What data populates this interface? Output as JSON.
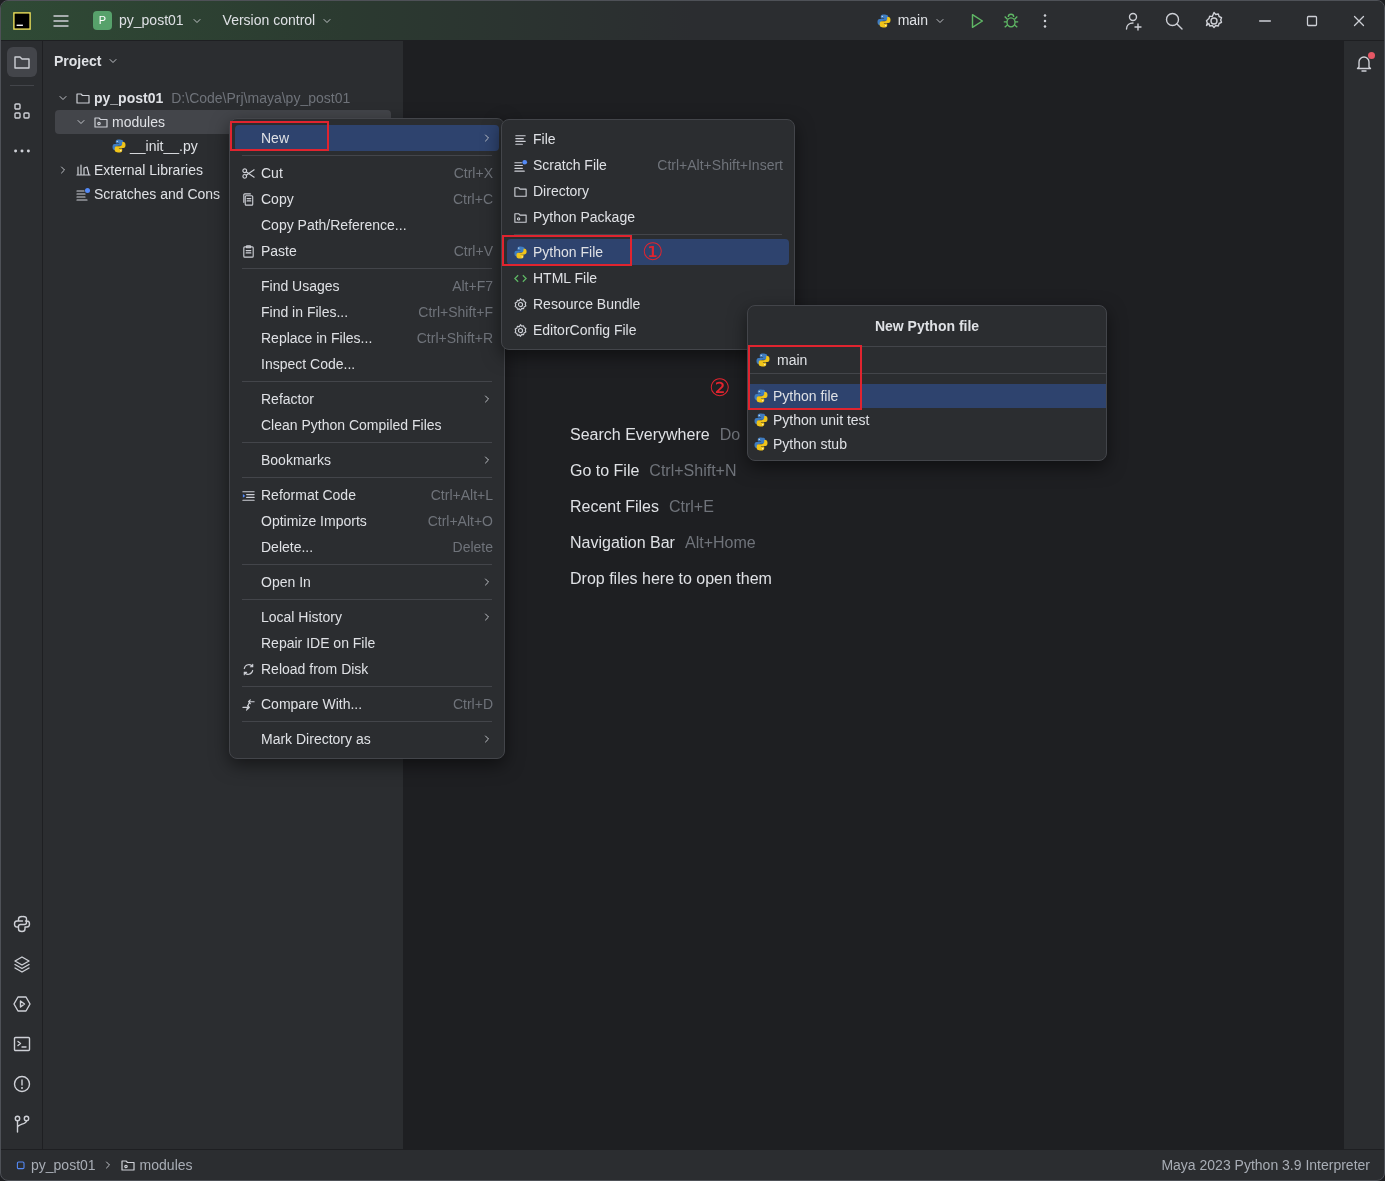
{
  "title_bar": {
    "project_badge": "P",
    "project": "py_post01",
    "vcs": "Version control",
    "run_config": "main"
  },
  "tool_windows_top": [
    {
      "selected": true
    },
    {
      "selected": false
    },
    {
      "selected": false
    }
  ],
  "project_panel": {
    "title": "Project",
    "tree": [
      {
        "label": "py_post01",
        "kind": "project",
        "path": "D:\\Code\\Prj\\maya\\py_post01",
        "expanded": true,
        "selected": false,
        "children": [
          {
            "label": "modules",
            "kind": "package",
            "expanded": true,
            "selected": true,
            "children": [
              {
                "label": "__init__.py",
                "kind": "python",
                "selected": false
              }
            ]
          }
        ]
      },
      {
        "label": "External Libraries",
        "kind": "library",
        "expanded": false,
        "selected": false
      },
      {
        "label": "Scratches and Cons",
        "kind": "scratches",
        "selected": false
      }
    ]
  },
  "context_menu": [
    {
      "kind": "item",
      "label": "New",
      "submenu": true,
      "selected": true,
      "annotated": true
    },
    {
      "kind": "separator"
    },
    {
      "kind": "item",
      "label": "Cut",
      "shortcut": "Ctrl+X",
      "selected": false
    },
    {
      "kind": "item",
      "label": "Copy",
      "shortcut": "Ctrl+C",
      "selected": false
    },
    {
      "kind": "item",
      "label": "Copy Path/Reference...",
      "selected": false
    },
    {
      "kind": "item",
      "label": "Paste",
      "shortcut": "Ctrl+V",
      "selected": false
    },
    {
      "kind": "separator"
    },
    {
      "kind": "item",
      "label": "Find Usages",
      "shortcut": "Alt+F7",
      "selected": false
    },
    {
      "kind": "item",
      "label": "Find in Files...",
      "shortcut": "Ctrl+Shift+F",
      "selected": false
    },
    {
      "kind": "item",
      "label": "Replace in Files...",
      "shortcut": "Ctrl+Shift+R",
      "selected": false
    },
    {
      "kind": "item",
      "label": "Inspect Code...",
      "selected": false
    },
    {
      "kind": "separator"
    },
    {
      "kind": "item",
      "label": "Refactor",
      "submenu": true,
      "selected": false
    },
    {
      "kind": "item",
      "label": "Clean Python Compiled Files",
      "selected": false
    },
    {
      "kind": "separator"
    },
    {
      "kind": "item",
      "label": "Bookmarks",
      "submenu": true,
      "selected": false
    },
    {
      "kind": "separator"
    },
    {
      "kind": "item",
      "label": "Reformat Code",
      "shortcut": "Ctrl+Alt+L",
      "selected": false
    },
    {
      "kind": "item",
      "label": "Optimize Imports",
      "shortcut": "Ctrl+Alt+O",
      "selected": false
    },
    {
      "kind": "item",
      "label": "Delete...",
      "shortcut": "Delete",
      "selected": false
    },
    {
      "kind": "separator"
    },
    {
      "kind": "item",
      "label": "Open In",
      "submenu": true,
      "selected": false
    },
    {
      "kind": "separator"
    },
    {
      "kind": "item",
      "label": "Local History",
      "submenu": true,
      "selected": false
    },
    {
      "kind": "item",
      "label": "Repair IDE on File",
      "selected": false
    },
    {
      "kind": "item",
      "label": "Reload from Disk",
      "selected": false
    },
    {
      "kind": "separator"
    },
    {
      "kind": "item",
      "label": "Compare With...",
      "shortcut": "Ctrl+D",
      "selected": false
    },
    {
      "kind": "separator"
    },
    {
      "kind": "item",
      "label": "Mark Directory as",
      "submenu": true,
      "selected": false
    }
  ],
  "new_submenu": [
    {
      "kind": "item",
      "label": "File",
      "selected": false
    },
    {
      "kind": "item",
      "label": "Scratch File",
      "shortcut": "Ctrl+Alt+Shift+Insert",
      "selected": false
    },
    {
      "kind": "item",
      "label": "Directory",
      "selected": false
    },
    {
      "kind": "item",
      "label": "Python Package",
      "selected": false
    },
    {
      "kind": "separator"
    },
    {
      "kind": "item",
      "label": "Python File",
      "selected": true,
      "annotated": true,
      "callout": "①"
    },
    {
      "kind": "item",
      "label": "HTML File",
      "selected": false
    },
    {
      "kind": "item",
      "label": "Resource Bundle",
      "selected": false
    },
    {
      "kind": "item",
      "label": "EditorConfig File",
      "selected": false
    }
  ],
  "new_python_file_popup": {
    "title": "New Python file",
    "name_value": "main",
    "annotated": true,
    "callout": "②",
    "templates": [
      {
        "label": "Python file",
        "selected": true
      },
      {
        "label": "Python unit test",
        "selected": false
      },
      {
        "label": "Python stub",
        "selected": false
      }
    ]
  },
  "editor_hints": [
    {
      "label": "Search Everywhere",
      "shortcut": "Do"
    },
    {
      "label": "Go to File",
      "shortcut": "Ctrl+Shift+N"
    },
    {
      "label": "Recent Files",
      "shortcut": "Ctrl+E"
    },
    {
      "label": "Navigation Bar",
      "shortcut": "Alt+Home"
    },
    {
      "label": "Drop files here to open them"
    }
  ],
  "notifications": {
    "unread": true
  },
  "status_bar": {
    "breadcrumbs": [
      "py_post01",
      "modules"
    ],
    "interpreter": "Maya 2023 Python 3.9 Interpreter"
  }
}
